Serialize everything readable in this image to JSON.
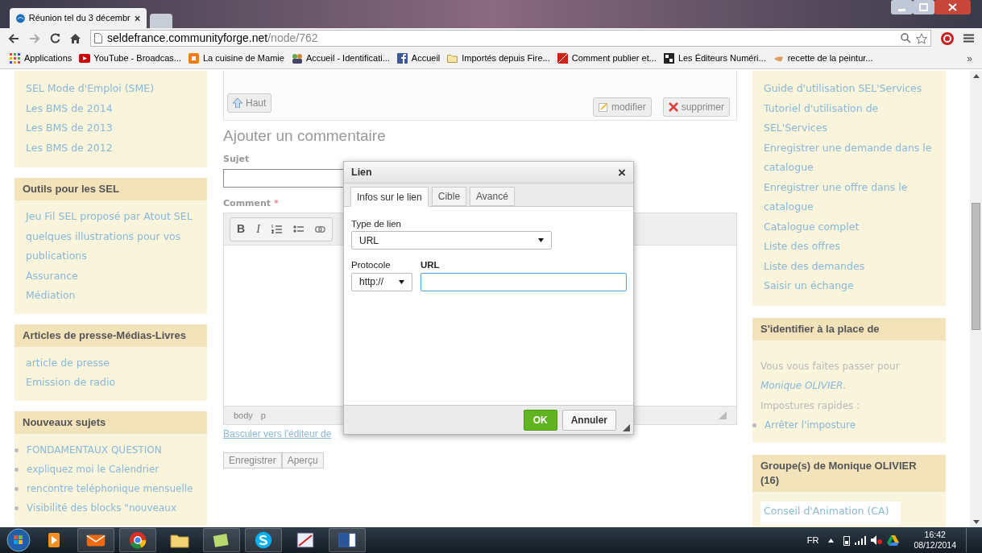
{
  "browser": {
    "tab_title": "Réunion tel du 3 décembr",
    "url_host": "seldefrance.communityforge.net",
    "url_path": "/node/762",
    "bookmarks": [
      {
        "label": "Applications"
      },
      {
        "label": "YouTube - Broadcas..."
      },
      {
        "label": "La cuisine de Mamie"
      },
      {
        "label": "Accueil - Identificati..."
      },
      {
        "label": "Accueil"
      },
      {
        "label": "Importés depuis Fire..."
      },
      {
        "label": "Comment publier et..."
      },
      {
        "label": "Les Éditeurs Numéri..."
      },
      {
        "label": "recette de la peintur..."
      }
    ],
    "more": "»"
  },
  "left_sidebar": {
    "blocks": [
      {
        "items": [
          {
            "label": "SEL Mode d'Emploi (SME)"
          },
          {
            "label": "Les BMS de 2014"
          },
          {
            "label": "Les BMS de 2013"
          },
          {
            "label": "Les BMS de 2012"
          }
        ],
        "kind": "links"
      },
      {
        "title": "Outils pour les SEL",
        "kind": "links",
        "items": [
          {
            "label": "Jeu Fil SEL proposé par Atout SEL"
          },
          {
            "label": "quelques illustrations pour vos publications"
          },
          {
            "label": "Assurance"
          },
          {
            "label": "Médiation"
          }
        ]
      },
      {
        "title": "Articles de presse-Médias-Livres",
        "kind": "links",
        "items": [
          {
            "label": "article de presse"
          },
          {
            "label": "Emission de radio"
          }
        ]
      },
      {
        "title": "Nouveaux sujets",
        "kind": "bullets",
        "items": [
          {
            "label": "FONDAMENTAUX QUESTION"
          },
          {
            "label": "expliquez moi le Calendrier"
          },
          {
            "label": "rencontre teléphonique mensuelle"
          },
          {
            "label": "Visibilité des blocks \"nouveaux"
          }
        ]
      }
    ]
  },
  "main": {
    "top_button": "Haut",
    "edit_button": "modifier",
    "delete_button": "supprimer",
    "form_title": "Ajouter un commentaire",
    "subject_label": "Sujet",
    "comment_label": "Comment",
    "required_mark": "*",
    "toolbar": [
      "B",
      "I"
    ],
    "editor_path": [
      "body",
      "p"
    ],
    "toggle_link": "Basculer vers l'éditeur de",
    "buttons": [
      "Enregistrer",
      "Aperçu"
    ]
  },
  "dialog": {
    "title": "Lien",
    "close": "×",
    "tabs": [
      {
        "label": "Infos sur le lien",
        "selected": true
      },
      {
        "label": "Cible",
        "selected": false
      },
      {
        "label": "Avancé",
        "selected": false
      }
    ],
    "link_type_label": "Type de lien",
    "link_type_value": "URL",
    "protocol_label": "Protocole",
    "protocol_value": "http://",
    "url_label": "URL",
    "url_focused": true,
    "ok": "OK",
    "cancel": "Annuler"
  },
  "right_sidebar": {
    "blocks": [
      {
        "kind": "links",
        "items": [
          {
            "label": "Guide d'utilisation SEL'Services"
          },
          {
            "label": "Tutoriel d'utilisation de SEL'Services"
          },
          {
            "label": "Enregistrer une demande dans le catalogue"
          },
          {
            "label": "Enregistrer une offre dans le catalogue"
          },
          {
            "label": "Catalogue complet"
          },
          {
            "label": "Liste des offres"
          },
          {
            "label": "Liste des demandes"
          },
          {
            "label": "Saisir un échange"
          }
        ]
      },
      {
        "title": "S'identifier à la place de",
        "kind": "mixed",
        "items": [
          {
            "label": "Vous vous faites passer pour",
            "kind": "text"
          },
          {
            "label": "Monique OLIVIER.",
            "kind": "name"
          },
          {
            "label": "Impostures rapides :",
            "kind": "text"
          },
          {
            "label": "Arrêter l'imposture",
            "kind": "bullet"
          }
        ]
      },
      {
        "title": "Groupe(s) de Monique OLIVIER (16)",
        "kind": "cards",
        "items": [
          {
            "label": "Conseil d'Animation (CA)"
          }
        ]
      }
    ]
  },
  "taskbar": {
    "language": "FR",
    "time": "16:42",
    "date": "08/12/2014"
  }
}
